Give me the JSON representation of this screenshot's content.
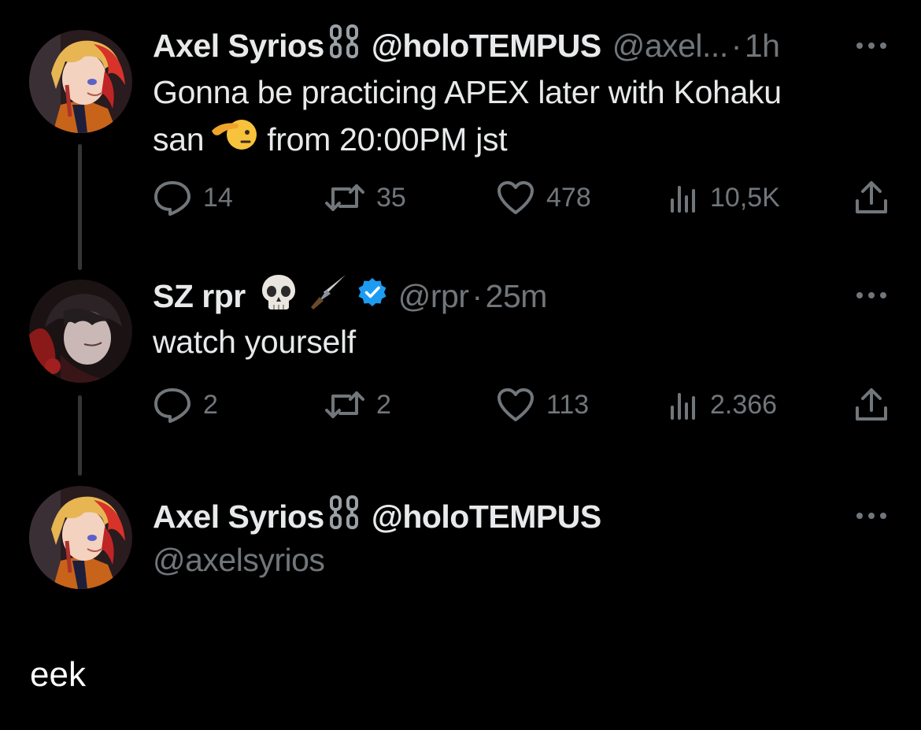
{
  "tweets": [
    {
      "display_name": "Axel Syrios",
      "name_emoji": "chain-icon",
      "name_suffix": "@holoTEMPUS",
      "handle": "@axel...",
      "separator": "·",
      "time": "1h",
      "text_line1": "Gonna be practicing APEX later with Kohaku",
      "text_line2_a": "san",
      "text_line2_emoji": "saluting-face-icon",
      "text_line2_b": "from 20:00PM jst",
      "replies": "14",
      "retweets": "35",
      "likes": "478",
      "views": "10,5K"
    },
    {
      "display_name": "SZ rpr",
      "name_emojis": [
        "skull-icon",
        "dagger-icon"
      ],
      "verified": true,
      "handle": "@rpr",
      "separator": "·",
      "time": "25m",
      "text": "watch yourself",
      "replies": "2",
      "retweets": "2",
      "likes": "113",
      "views": "2.366"
    },
    {
      "display_name": "Axel Syrios",
      "name_emoji": "chain-icon",
      "name_suffix": "@holoTEMPUS",
      "handle": "@axelsyrios"
    }
  ],
  "caption": "eek",
  "colors": {
    "background": "#000000",
    "primary_text": "#e7e9ea",
    "secondary_text": "#71767b",
    "verified_badge": "#1d9bf0",
    "thread_line": "#333639"
  }
}
